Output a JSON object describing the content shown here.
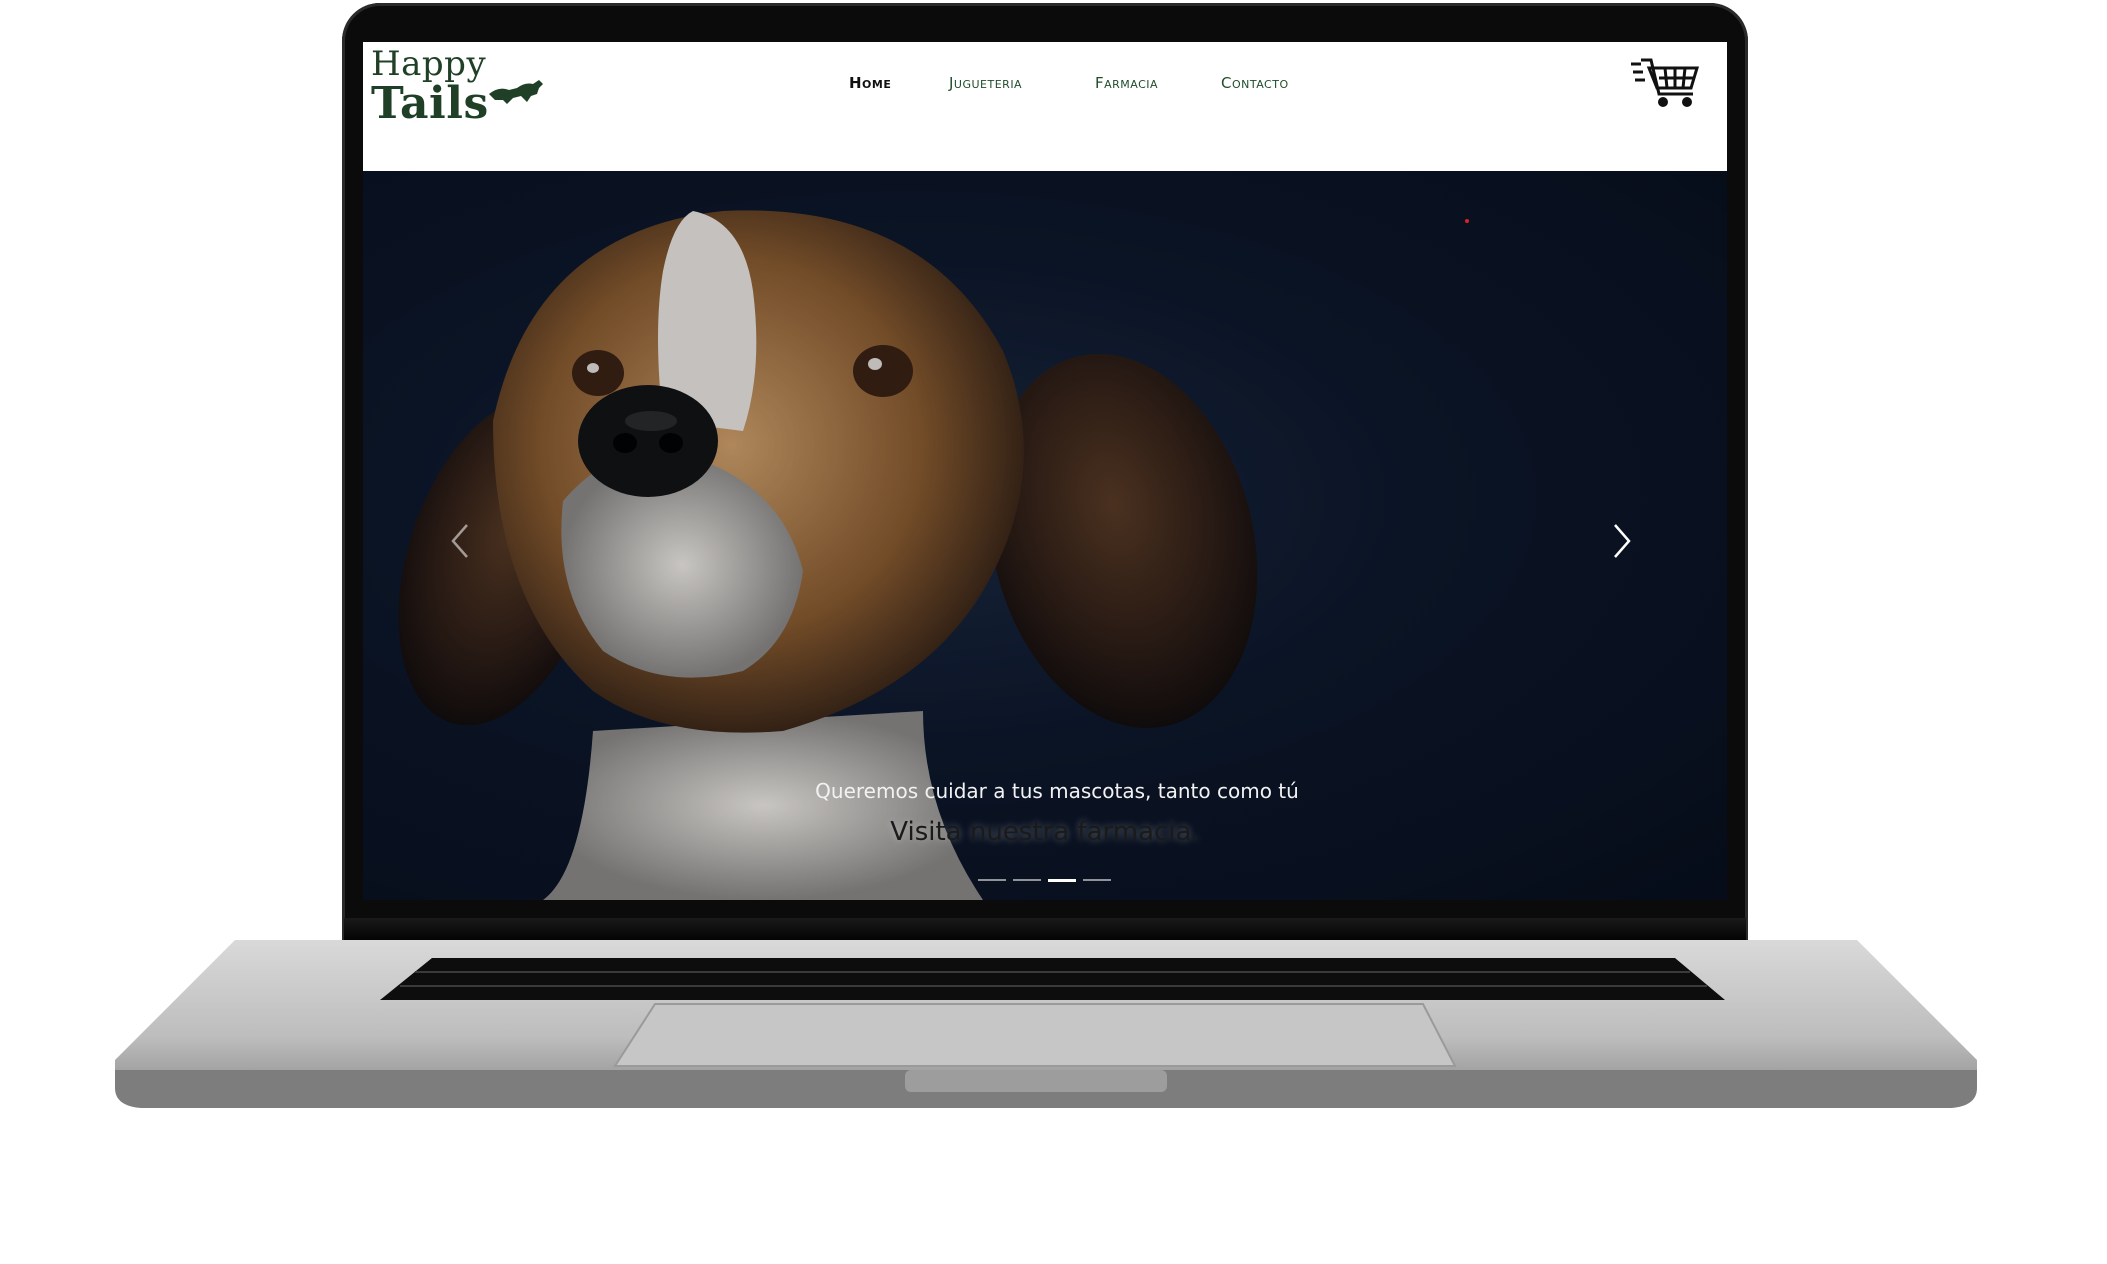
{
  "brand": {
    "line1": "Happy",
    "line2": "Tails",
    "color": "#1f3f26"
  },
  "nav": {
    "items": [
      {
        "label": "Home",
        "active": true
      },
      {
        "label": "Jugueteria",
        "active": false
      },
      {
        "label": "Farmacia",
        "active": false
      },
      {
        "label": "Contacto",
        "active": false
      }
    ]
  },
  "cart": {
    "icon": "shopping-cart-icon"
  },
  "hero": {
    "caption_line1": "Queremos cuidar a tus mascotas, tanto como tú",
    "caption_line2": "Visita nuestra farmacia.",
    "slides_count": 4,
    "active_slide": 3,
    "prev_icon": "chevron-left-icon",
    "next_icon": "chevron-right-icon"
  },
  "colors": {
    "accent": "#1f4d2a",
    "hero_bg": "#0c1628"
  }
}
